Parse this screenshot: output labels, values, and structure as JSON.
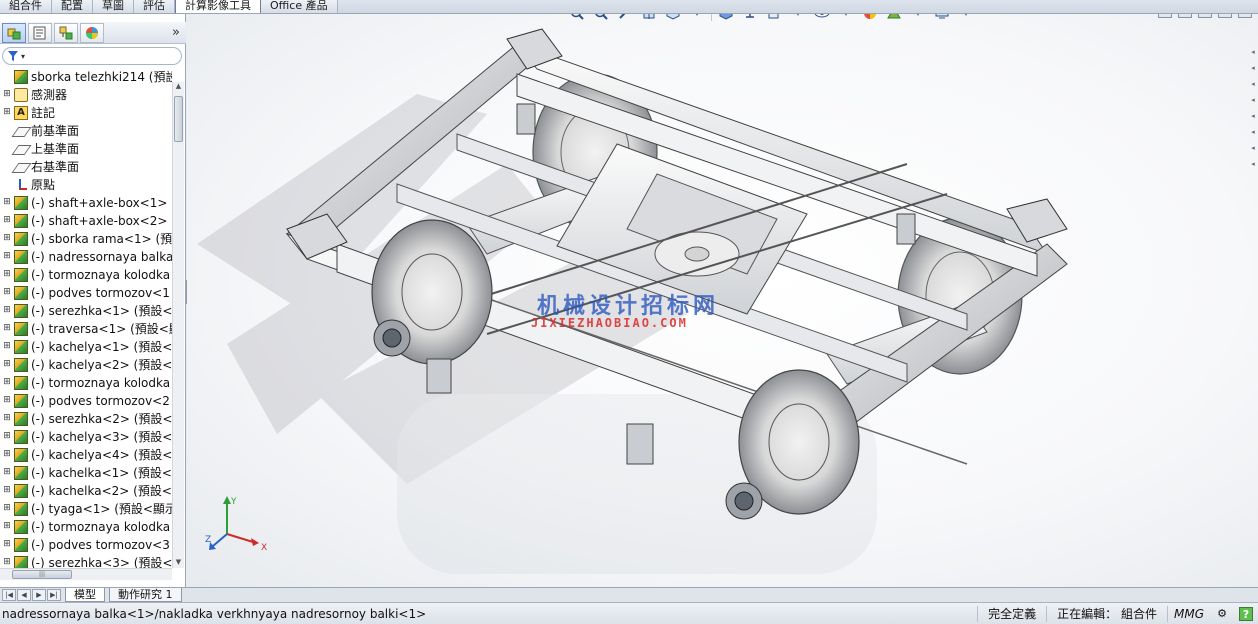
{
  "command_tabs": [
    {
      "label": "組合件",
      "active": false
    },
    {
      "label": "配置",
      "active": false
    },
    {
      "label": "草圖",
      "active": false
    },
    {
      "label": "評估",
      "active": false
    },
    {
      "label": "計算影像工具",
      "active": true
    },
    {
      "label": "Office 產品",
      "active": false
    }
  ],
  "feature_tree": {
    "root": "sborka telezhki214 (預設<",
    "items": [
      {
        "label": "感測器",
        "icon": "sensor-icon"
      },
      {
        "label": "註記",
        "icon": "annotation-icon"
      },
      {
        "label": "前基準面",
        "icon": "plane-icon"
      },
      {
        "label": "上基準面",
        "icon": "plane-icon"
      },
      {
        "label": "右基準面",
        "icon": "plane-icon"
      },
      {
        "label": "原點",
        "icon": "origin-icon"
      },
      {
        "label": "(-) shaft+axle-box<1>",
        "icon": "subassembly-icon"
      },
      {
        "label": "(-) shaft+axle-box<2>",
        "icon": "subassembly-icon"
      },
      {
        "label": "(-) sborka rama<1> (預",
        "icon": "subassembly-icon"
      },
      {
        "label": "(-) nadressornaya balka",
        "icon": "subassembly-icon"
      },
      {
        "label": "(-) tormoznaya kolodka",
        "icon": "subassembly-icon"
      },
      {
        "label": "(-) podves tormozov<1",
        "icon": "subassembly-icon"
      },
      {
        "label": "(-) serezhka<1> (預設<",
        "icon": "subassembly-icon"
      },
      {
        "label": "(-) traversa<1> (預設<顯",
        "icon": "subassembly-icon"
      },
      {
        "label": "(-) kachelya<1> (預設<",
        "icon": "subassembly-icon"
      },
      {
        "label": "(-) kachelya<2> (預設<",
        "icon": "subassembly-icon"
      },
      {
        "label": "(-) tormoznaya kolodka",
        "icon": "subassembly-icon"
      },
      {
        "label": "(-) podves tormozov<2",
        "icon": "subassembly-icon"
      },
      {
        "label": "(-) serezhka<2> (預設<",
        "icon": "subassembly-icon"
      },
      {
        "label": "(-) kachelya<3> (預設<",
        "icon": "subassembly-icon"
      },
      {
        "label": "(-) kachelya<4> (預設<",
        "icon": "subassembly-icon"
      },
      {
        "label": "(-) kachelka<1> (預設<",
        "icon": "subassembly-icon"
      },
      {
        "label": "(-) kachelka<2> (預設<",
        "icon": "subassembly-icon"
      },
      {
        "label": "(-) tyaga<1> (預設<顯示",
        "icon": "subassembly-icon"
      },
      {
        "label": "(-) tormoznaya kolodka",
        "icon": "subassembly-icon"
      },
      {
        "label": "(-) podves tormozov<3",
        "icon": "subassembly-icon"
      },
      {
        "label": "(-) serezhka<3> (預設<",
        "icon": "subassembly-icon"
      }
    ]
  },
  "watermark": {
    "line1": "机械设计招标网",
    "line2": "JIXIEZHAOBIAO.COM"
  },
  "triad": {
    "x": "X",
    "y": "Y",
    "z": "Z"
  },
  "model_tabs": [
    {
      "label": "模型",
      "active": true
    },
    {
      "label": "動作研究 1",
      "active": false
    }
  ],
  "status_bar": {
    "path": "nadressornaya balka<1>/nakladka verkhnyaya nadresornoy balki<1>",
    "definition": "完全定義",
    "editing": "正在編輯： 組合件",
    "units": "MMG",
    "help": "?"
  },
  "colors": {
    "accent": "#1f5fbf",
    "tab_active_border": "#6f7f96",
    "watermark_blue": "#2855be",
    "watermark_red": "#dc2828"
  }
}
